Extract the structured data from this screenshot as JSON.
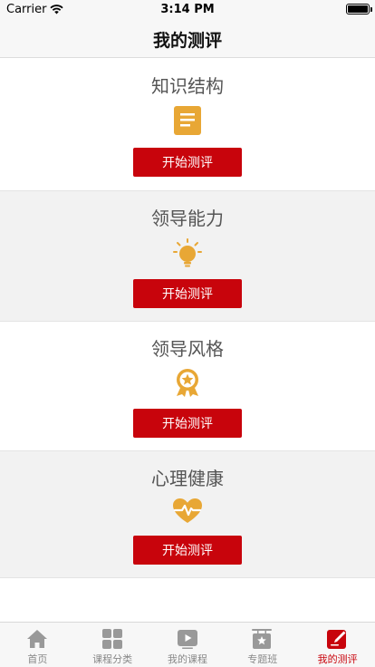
{
  "status_bar": {
    "carrier": "Carrier",
    "time": "3:14 PM"
  },
  "nav": {
    "title": "我的测评"
  },
  "sections": [
    {
      "title": "知识结构",
      "icon": "document-icon",
      "button": "开始测评"
    },
    {
      "title": "领导能力",
      "icon": "lightbulb-icon",
      "button": "开始测评"
    },
    {
      "title": "领导风格",
      "icon": "award-badge-icon",
      "button": "开始测评"
    },
    {
      "title": "心理健康",
      "icon": "heart-pulse-icon",
      "button": "开始测评"
    }
  ],
  "tabs": [
    {
      "label": "首页",
      "icon": "home-icon",
      "active": false
    },
    {
      "label": "课程分类",
      "icon": "grid-icon",
      "active": false
    },
    {
      "label": "我的课程",
      "icon": "play-icon",
      "active": false
    },
    {
      "label": "专题班",
      "icon": "star-board-icon",
      "active": false
    },
    {
      "label": "我的测评",
      "icon": "edit-note-icon",
      "active": true
    }
  ],
  "colors": {
    "accent": "#c8040c",
    "icon_gold": "#e8a735",
    "tab_gray": "#999999"
  }
}
